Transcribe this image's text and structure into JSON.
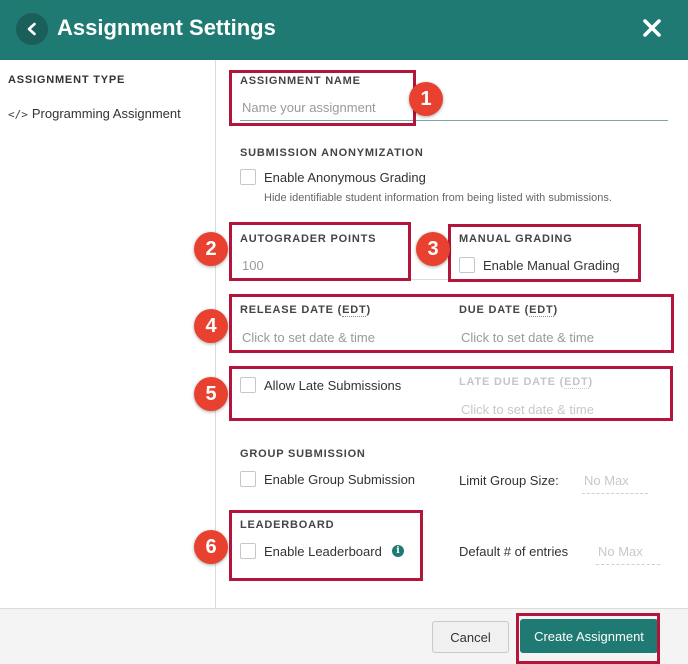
{
  "header": {
    "title": "Assignment Settings",
    "back_icon": "chevron-left-icon",
    "close_icon": "close-x-icon",
    "color": "#1f7a73"
  },
  "sidebar": {
    "heading": "ASSIGNMENT TYPE",
    "item_icon": "</>",
    "item_label": "Programming Assignment"
  },
  "form": {
    "assignment_name": {
      "label": "ASSIGNMENT NAME",
      "placeholder": "Name your assignment"
    },
    "anonymization": {
      "label": "SUBMISSION ANONYMIZATION",
      "checkbox_label": "Enable Anonymous Grading",
      "help": "Hide identifiable student information from being listed with submissions."
    },
    "autograder_points": {
      "label": "AUTOGRADER POINTS",
      "value": "100"
    },
    "manual_grading": {
      "label": "MANUAL GRADING",
      "checkbox_label": "Enable Manual Grading"
    },
    "release_date": {
      "label_prefix": "RELEASE DATE (",
      "label_abbr": "EDT",
      "label_suffix": ")",
      "placeholder": "Click to set date & time"
    },
    "due_date": {
      "label_prefix": "DUE DATE (",
      "label_abbr": "EDT",
      "label_suffix": ")",
      "placeholder": "Click to set date & time"
    },
    "late_submissions": {
      "checkbox_label": "Allow Late Submissions"
    },
    "late_due_date": {
      "label_prefix": "LATE DUE DATE (",
      "label_abbr": "EDT",
      "label_suffix": ")",
      "placeholder": "Click to set date & time"
    },
    "group_submission": {
      "label": "GROUP SUBMISSION",
      "checkbox_label": "Enable Group Submission",
      "limit_label": "Limit Group Size:",
      "limit_placeholder": "No Max"
    },
    "leaderboard": {
      "label": "LEADERBOARD",
      "checkbox_label": "Enable Leaderboard",
      "info_icon": "i",
      "entries_label": "Default # of entries",
      "entries_placeholder": "No Max"
    }
  },
  "badges": [
    "1",
    "2",
    "3",
    "4",
    "5",
    "6"
  ],
  "annotation_color": "#b3163a",
  "badge_color": "#e8412f",
  "footer": {
    "cancel_label": "Cancel",
    "create_label": "Create Assignment"
  }
}
